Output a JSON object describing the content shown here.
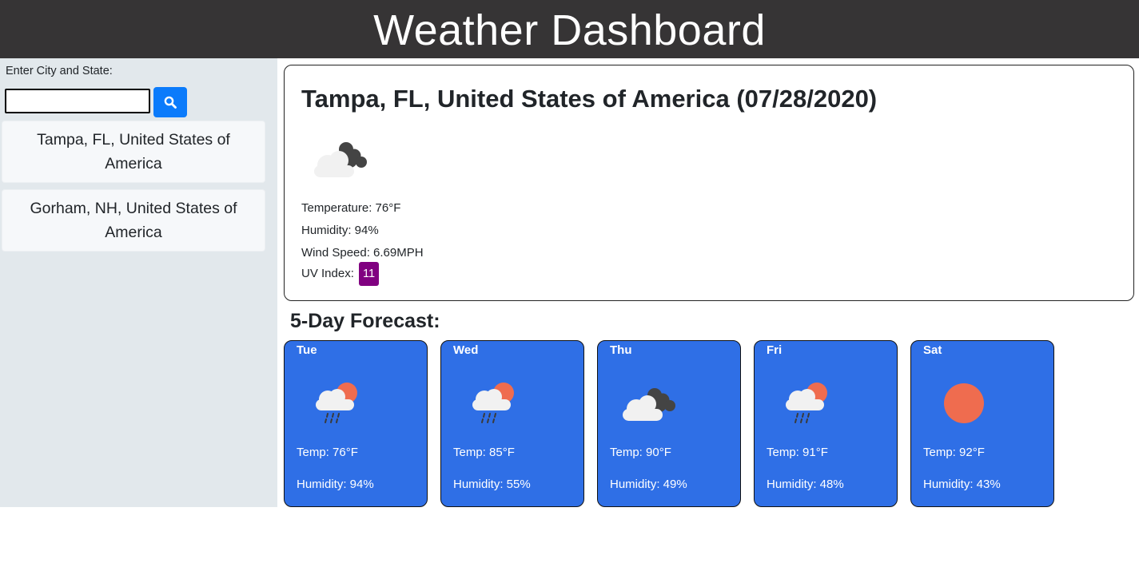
{
  "header": {
    "title": "Weather Dashboard"
  },
  "sidebar": {
    "search_label": "Enter City and State:",
    "search_value": "",
    "search_placeholder": "",
    "search_icon": "magnifying-glass",
    "history": [
      {
        "label": "Tampa, FL, United States of America"
      },
      {
        "label": "Gorham, NH, United States of America"
      }
    ]
  },
  "current": {
    "title": "Tampa, FL, United States of America (07/28/2020)",
    "icon": "cloudy",
    "temperature": "Temperature: 76°F",
    "humidity": "Humidity: 94%",
    "wind": "Wind Speed: 6.69MPH",
    "uv_label": "UV Index:",
    "uv_value": "11"
  },
  "forecast": {
    "title": "5-Day Forecast:",
    "days": [
      {
        "day": "Tue",
        "icon": "rain-sun",
        "temp": "Temp: 76°F",
        "humidity": "Humidity: 94%"
      },
      {
        "day": "Wed",
        "icon": "rain-sun",
        "temp": "Temp: 85°F",
        "humidity": "Humidity: 55%"
      },
      {
        "day": "Thu",
        "icon": "cloudy",
        "temp": "Temp: 90°F",
        "humidity": "Humidity: 49%"
      },
      {
        "day": "Fri",
        "icon": "rain-sun",
        "temp": "Temp: 91°F",
        "humidity": "Humidity: 48%"
      },
      {
        "day": "Sat",
        "icon": "sun",
        "temp": "Temp: 92°F",
        "humidity": "Humidity: 43%"
      }
    ]
  },
  "colors": {
    "header_bg": "#363435",
    "sidebar_bg": "#e2e8ec",
    "search_button": "#0b7bfb",
    "forecast_card": "#2f6fe6",
    "uv_badge": "#800080",
    "sun": "#ef6c4f"
  }
}
